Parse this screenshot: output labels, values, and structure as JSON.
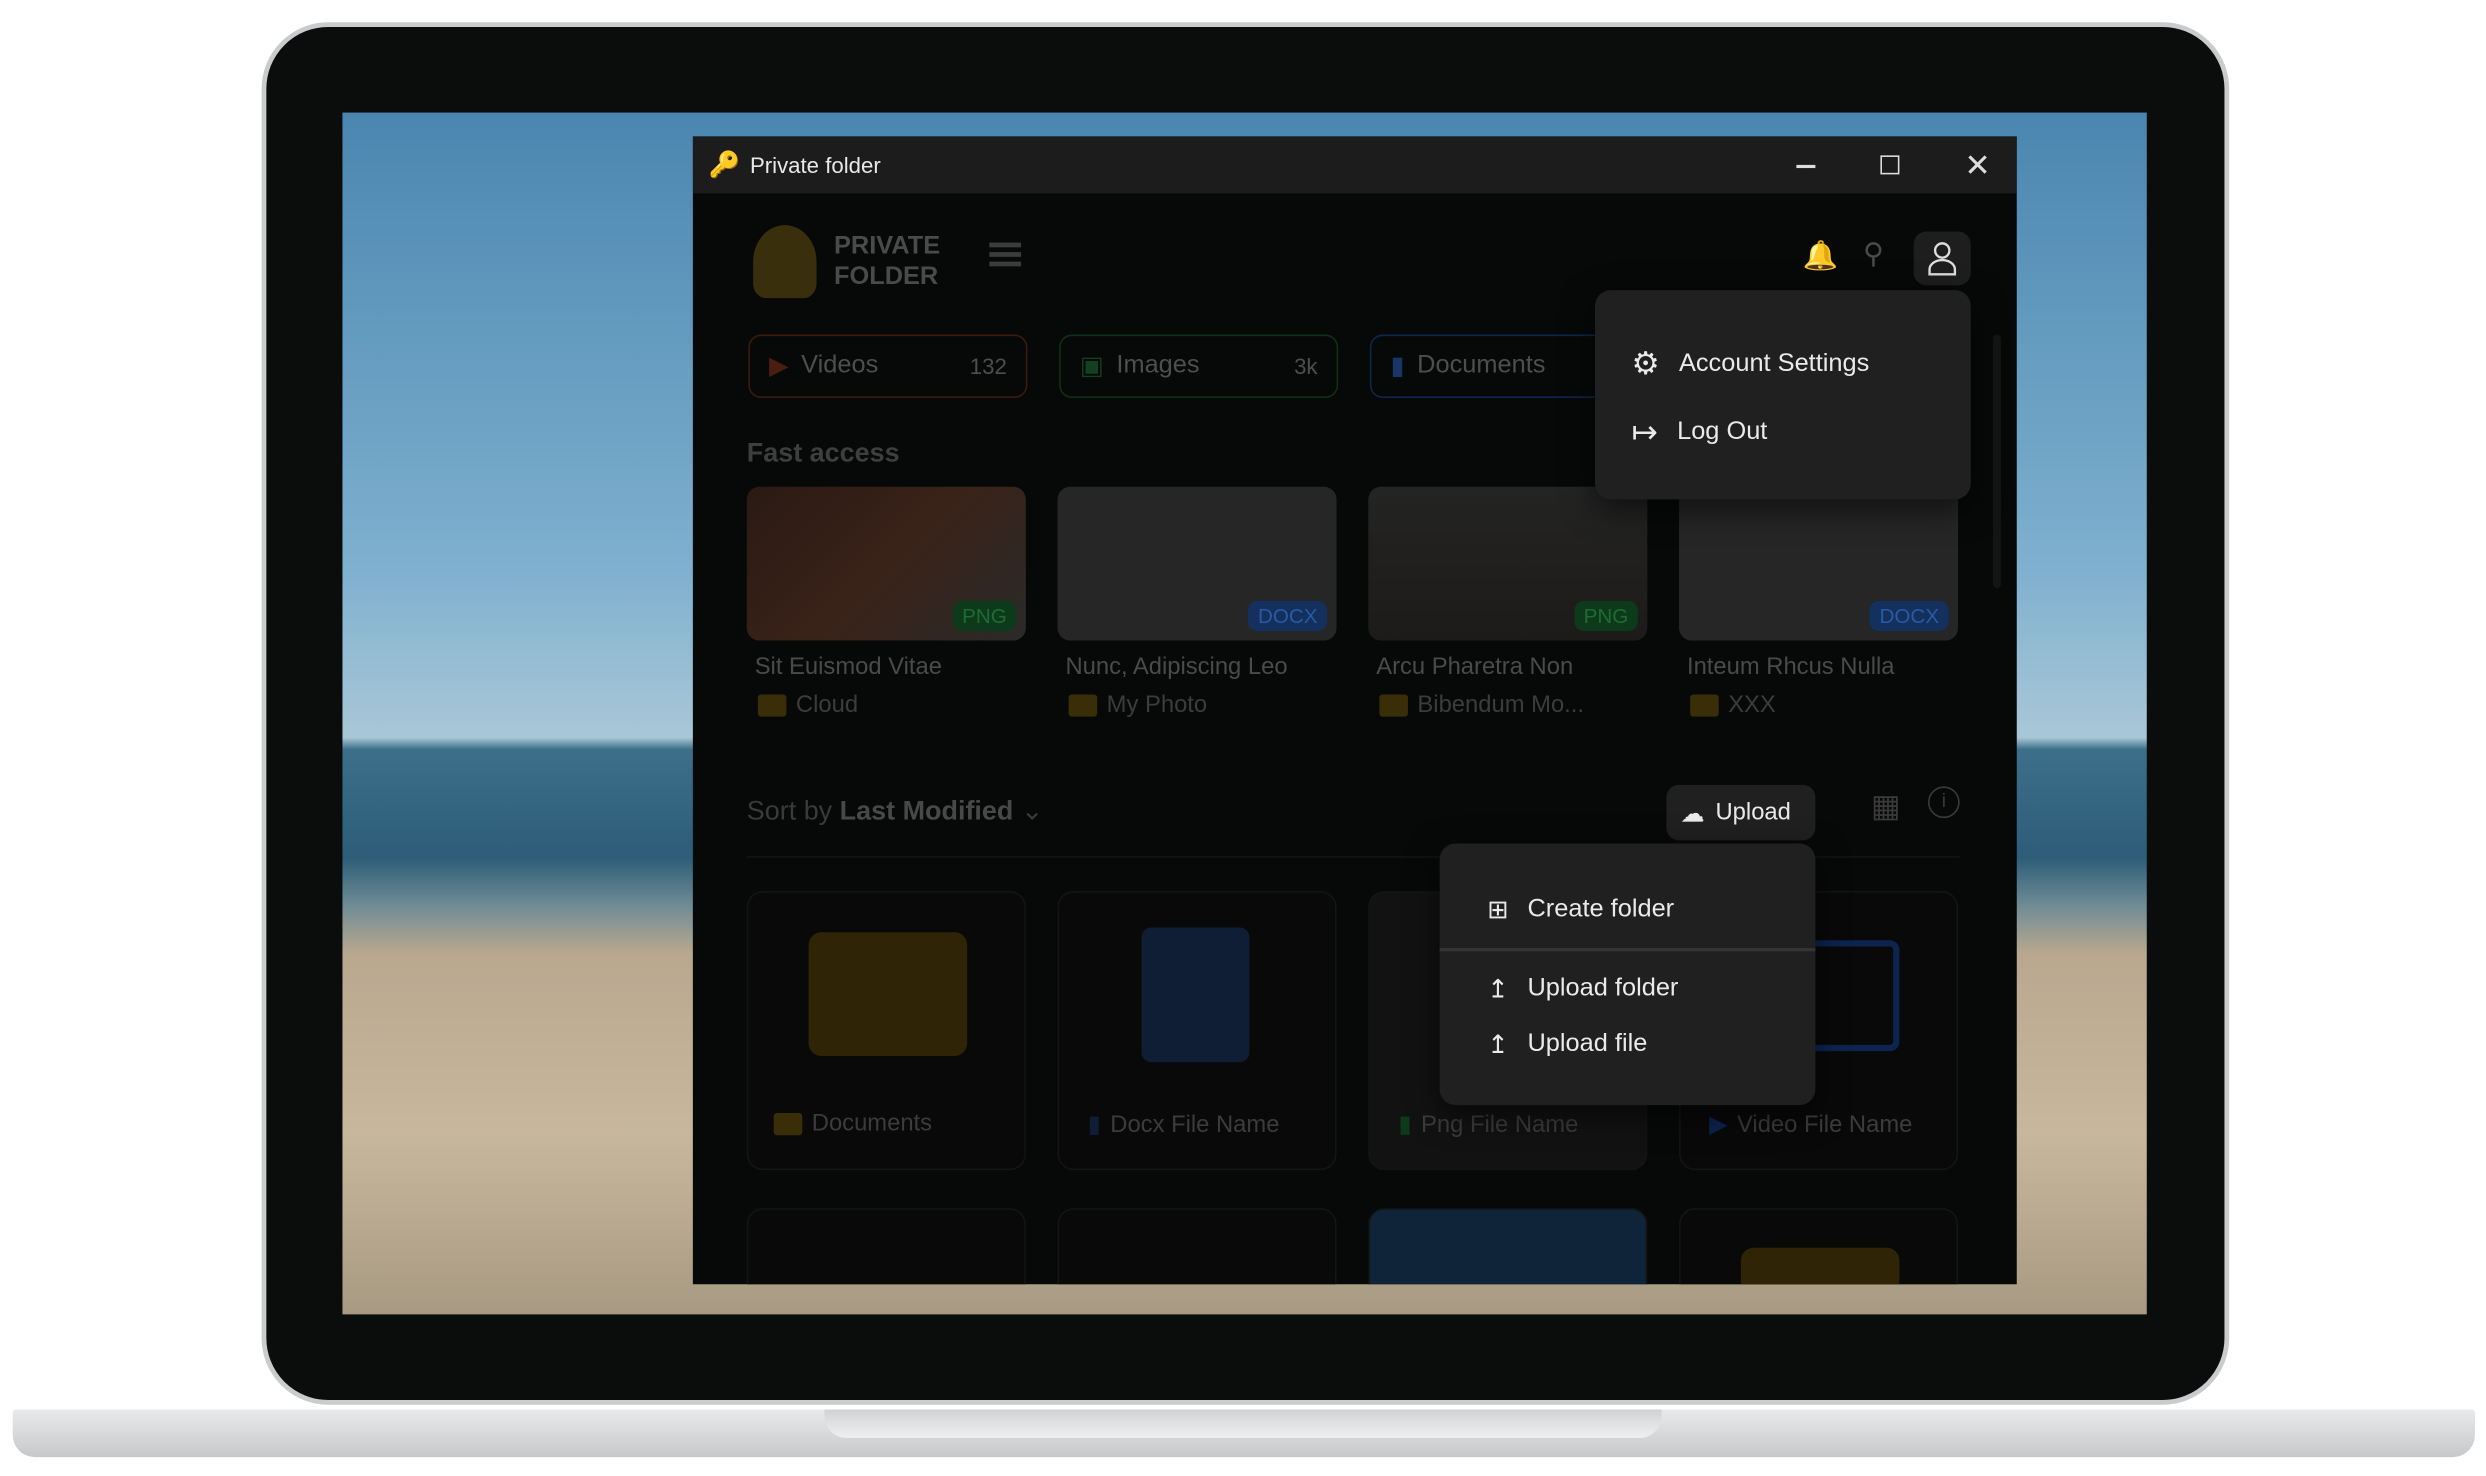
{
  "window": {
    "title": "Private folder"
  },
  "app": {
    "logo_line1": "PRIVATE",
    "logo_line2": "FOLDER"
  },
  "header": {
    "icons": [
      "bell-icon",
      "search-icon",
      "user-icon"
    ]
  },
  "account_menu": {
    "items": [
      {
        "label": "Account Settings",
        "icon": "gear-icon"
      },
      {
        "label": "Log Out",
        "icon": "logout-icon"
      }
    ]
  },
  "categories": [
    {
      "label": "Videos",
      "count": "132",
      "color": "#e0562e"
    },
    {
      "label": "Images",
      "count": "3k",
      "color": "#2fa84f"
    },
    {
      "label": "Documents",
      "count": "",
      "color": "#2f6fd6"
    }
  ],
  "fast_access": {
    "title": "Fast access",
    "items": [
      {
        "title": "Sit Euismod Vitae",
        "folder": "Cloud",
        "type": "PNG"
      },
      {
        "title": "Nunc, Adipiscing Leo",
        "folder": "My Photo",
        "type": "DOCX"
      },
      {
        "title": "Arcu Pharetra Non",
        "folder": "Bibendum Mo...",
        "type": "PNG"
      },
      {
        "title": "Inteum Rhcus Nulla",
        "folder": "XXX",
        "type": "DOCX"
      }
    ]
  },
  "toolbar": {
    "sort_prefix": "Sort by",
    "sort_value": "Last Modified",
    "upload_label": "Upload"
  },
  "upload_menu": {
    "items": [
      {
        "label": "Create folder"
      },
      {
        "label": "Upload folder"
      },
      {
        "label": "Upload file"
      }
    ]
  },
  "files": [
    {
      "name": "Documents",
      "kind": "folder"
    },
    {
      "name": "Docx File Name",
      "kind": "docx"
    },
    {
      "name": "Png File Name",
      "kind": "png"
    },
    {
      "name": "Video File Name",
      "kind": "video"
    }
  ]
}
